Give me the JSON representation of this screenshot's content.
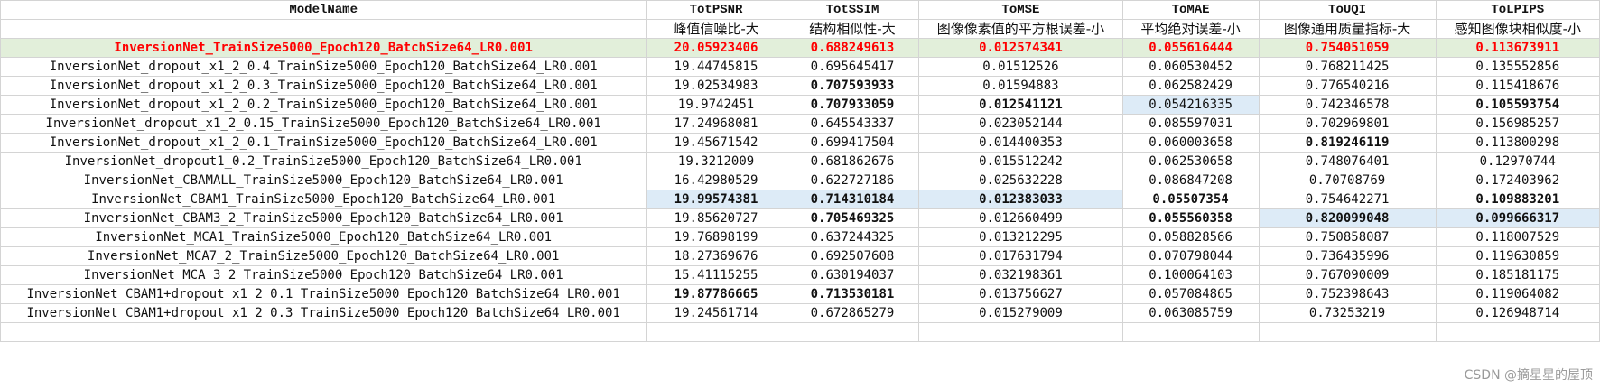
{
  "headers": [
    "ModelName",
    "TotPSNR",
    "TotSSIM",
    "ToMSE",
    "ToMAE",
    "ToUQI",
    "ToLPIPS"
  ],
  "subheaders": [
    "",
    "峰值信噪比-大",
    "结构相似性-大",
    "图像像素值的平方根误差-小",
    "平均绝对误差-小",
    "图像通用质量指标-大",
    "感知图像块相似度-小"
  ],
  "rows": [
    {
      "cells": [
        "InversionNet_TrainSize5000_Epoch120_BatchSize64_LR0.001",
        "20.05923406",
        "0.688249613",
        "0.012574341",
        "0.055616444",
        "0.754051059",
        "0.113673911"
      ],
      "best": true,
      "bold": [],
      "hl": []
    },
    {
      "cells": [
        "InversionNet_dropout_x1_2_0.4_TrainSize5000_Epoch120_BatchSize64_LR0.001",
        "19.44745815",
        "0.695645417",
        "0.01512526",
        "0.060530452",
        "0.768211425",
        "0.135552856"
      ],
      "bold": [],
      "hl": []
    },
    {
      "cells": [
        "InversionNet_dropout_x1_2_0.3_TrainSize5000_Epoch120_BatchSize64_LR0.001",
        "19.02534983",
        "0.707593933",
        "0.01594883",
        "0.062582429",
        "0.776540216",
        "0.115418676"
      ],
      "bold": [
        2
      ],
      "hl": []
    },
    {
      "cells": [
        "InversionNet_dropout_x1_2_0.2_TrainSize5000_Epoch120_BatchSize64_LR0.001",
        "19.9742451",
        "0.707933059",
        "0.012541121",
        "0.054216335",
        "0.742346578",
        "0.105593754"
      ],
      "bold": [
        2,
        3,
        6
      ],
      "hl": [
        4
      ]
    },
    {
      "cells": [
        "InversionNet_dropout_x1_2_0.15_TrainSize5000_Epoch120_BatchSize64_LR0.001",
        "17.24968081",
        "0.645543337",
        "0.023052144",
        "0.085597031",
        "0.702969801",
        "0.156985257"
      ],
      "bold": [],
      "hl": []
    },
    {
      "cells": [
        "InversionNet_dropout_x1_2_0.1_TrainSize5000_Epoch120_BatchSize64_LR0.001",
        "19.45671542",
        "0.699417504",
        "0.014400353",
        "0.060003658",
        "0.819246119",
        "0.113800298"
      ],
      "bold": [
        5
      ],
      "hl": []
    },
    {
      "cells": [
        "InversionNet_dropout1_0.2_TrainSize5000_Epoch120_BatchSize64_LR0.001",
        "19.3212009",
        "0.681862676",
        "0.015512242",
        "0.062530658",
        "0.748076401",
        "0.12970744"
      ],
      "bold": [],
      "hl": []
    },
    {
      "cells": [
        "InversionNet_CBAMALL_TrainSize5000_Epoch120_BatchSize64_LR0.001",
        "16.42980529",
        "0.622727186",
        "0.025632228",
        "0.086847208",
        "0.70708769",
        "0.172403962"
      ],
      "bold": [],
      "hl": []
    },
    {
      "cells": [
        "InversionNet_CBAM1_TrainSize5000_Epoch120_BatchSize64_LR0.001",
        "19.99574381",
        "0.714310184",
        "0.012383033",
        "0.05507354",
        "0.754642271",
        "0.109883201"
      ],
      "bold": [
        1,
        2,
        3,
        4,
        6
      ],
      "hl": [
        1,
        2,
        3
      ]
    },
    {
      "cells": [
        "InversionNet_CBAM3_2_TrainSize5000_Epoch120_BatchSize64_LR0.001",
        "19.85620727",
        "0.705469325",
        "0.012660499",
        "0.055560358",
        "0.820099048",
        "0.099666317"
      ],
      "bold": [
        2,
        4,
        5,
        6
      ],
      "hl": [
        5,
        6
      ]
    },
    {
      "cells": [
        "InversionNet_MCA1_TrainSize5000_Epoch120_BatchSize64_LR0.001",
        "19.76898199",
        "0.637244325",
        "0.013212295",
        "0.058828566",
        "0.750858087",
        "0.118007529"
      ],
      "bold": [],
      "hl": []
    },
    {
      "cells": [
        "InversionNet_MCA7_2_TrainSize5000_Epoch120_BatchSize64_LR0.001",
        "18.27369676",
        "0.692507608",
        "0.017631794",
        "0.070798044",
        "0.736435996",
        "0.119630859"
      ],
      "bold": [],
      "hl": []
    },
    {
      "cells": [
        "InversionNet_MCA_3_2_TrainSize5000_Epoch120_BatchSize64_LR0.001",
        "15.41115255",
        "0.630194037",
        "0.032198361",
        "0.100064103",
        "0.767090009",
        "0.185181175"
      ],
      "bold": [],
      "hl": []
    },
    {
      "cells": [
        "InversionNet_CBAM1+dropout_x1_2_0.1_TrainSize5000_Epoch120_BatchSize64_LR0.001",
        "19.87786665",
        "0.713530181",
        "0.013756627",
        "0.057084865",
        "0.752398643",
        "0.119064082"
      ],
      "bold": [
        1,
        2
      ],
      "hl": []
    },
    {
      "cells": [
        "InversionNet_CBAM1+dropout_x1_2_0.3_TrainSize5000_Epoch120_BatchSize64_LR0.001",
        "19.24561714",
        "0.672865279",
        "0.015279009",
        "0.063085759",
        "0.73253219",
        "0.126948714"
      ],
      "bold": [],
      "hl": []
    }
  ],
  "empty_rows": 1,
  "watermark": "CSDN @摘星星的屋顶",
  "colors": {
    "best_bg": "#e2efda",
    "best_text": "#ff0000",
    "highlight_bg": "#ddebf7",
    "grid": "#d4d4d4"
  }
}
